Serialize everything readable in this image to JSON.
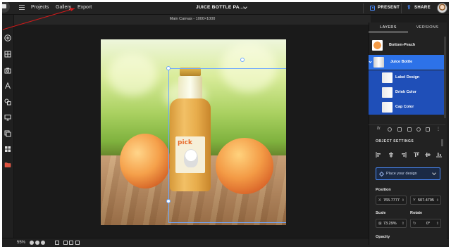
{
  "topbar": {
    "nav": [
      "Projects",
      "Gallery",
      "Export"
    ],
    "doc_title": "JUICE BOTTLE PA...",
    "present_label": "PRESENT",
    "share_label": "SHARE"
  },
  "canvas": {
    "label": "Main Canvas - 1000×1000",
    "artwork_brand": "pick"
  },
  "left_toolbar": {
    "tools": [
      "add-icon",
      "grid-icon",
      "camera-icon",
      "text-icon",
      "shapes-icon",
      "monitor-icon",
      "duplicate-icon",
      "layout-icon",
      "folder-icon"
    ]
  },
  "bottom_bar": {
    "zoom": "55%"
  },
  "right_panel": {
    "tabs": [
      "LAYERS",
      "VERSIONS"
    ],
    "active_tab": "LAYERS",
    "layers": [
      {
        "label": "Bottom-Peach",
        "selected": false
      },
      {
        "label": "Juice Bottle",
        "selected": true
      },
      {
        "label": "Label Design",
        "selected": true
      },
      {
        "label": "Drink Color",
        "selected": true
      },
      {
        "label": "Cap Color",
        "selected": true
      }
    ],
    "object_settings_title": "OBJECT SETTINGS",
    "design_dropdown": "Place your design",
    "position_label": "Position",
    "position_x_prefix": "X",
    "position_x": "765.7777",
    "position_y_prefix": "Y",
    "position_y": "507.4795",
    "scale_label": "Scale",
    "scale_value": "73.29%",
    "rotate_label": "Rotate",
    "rotate_value": "0°",
    "opacity_label": "Opacity"
  },
  "colors": {
    "accent": "#2d72e8",
    "selection": "#6ea8ff",
    "annotation": "#d11a1a"
  }
}
